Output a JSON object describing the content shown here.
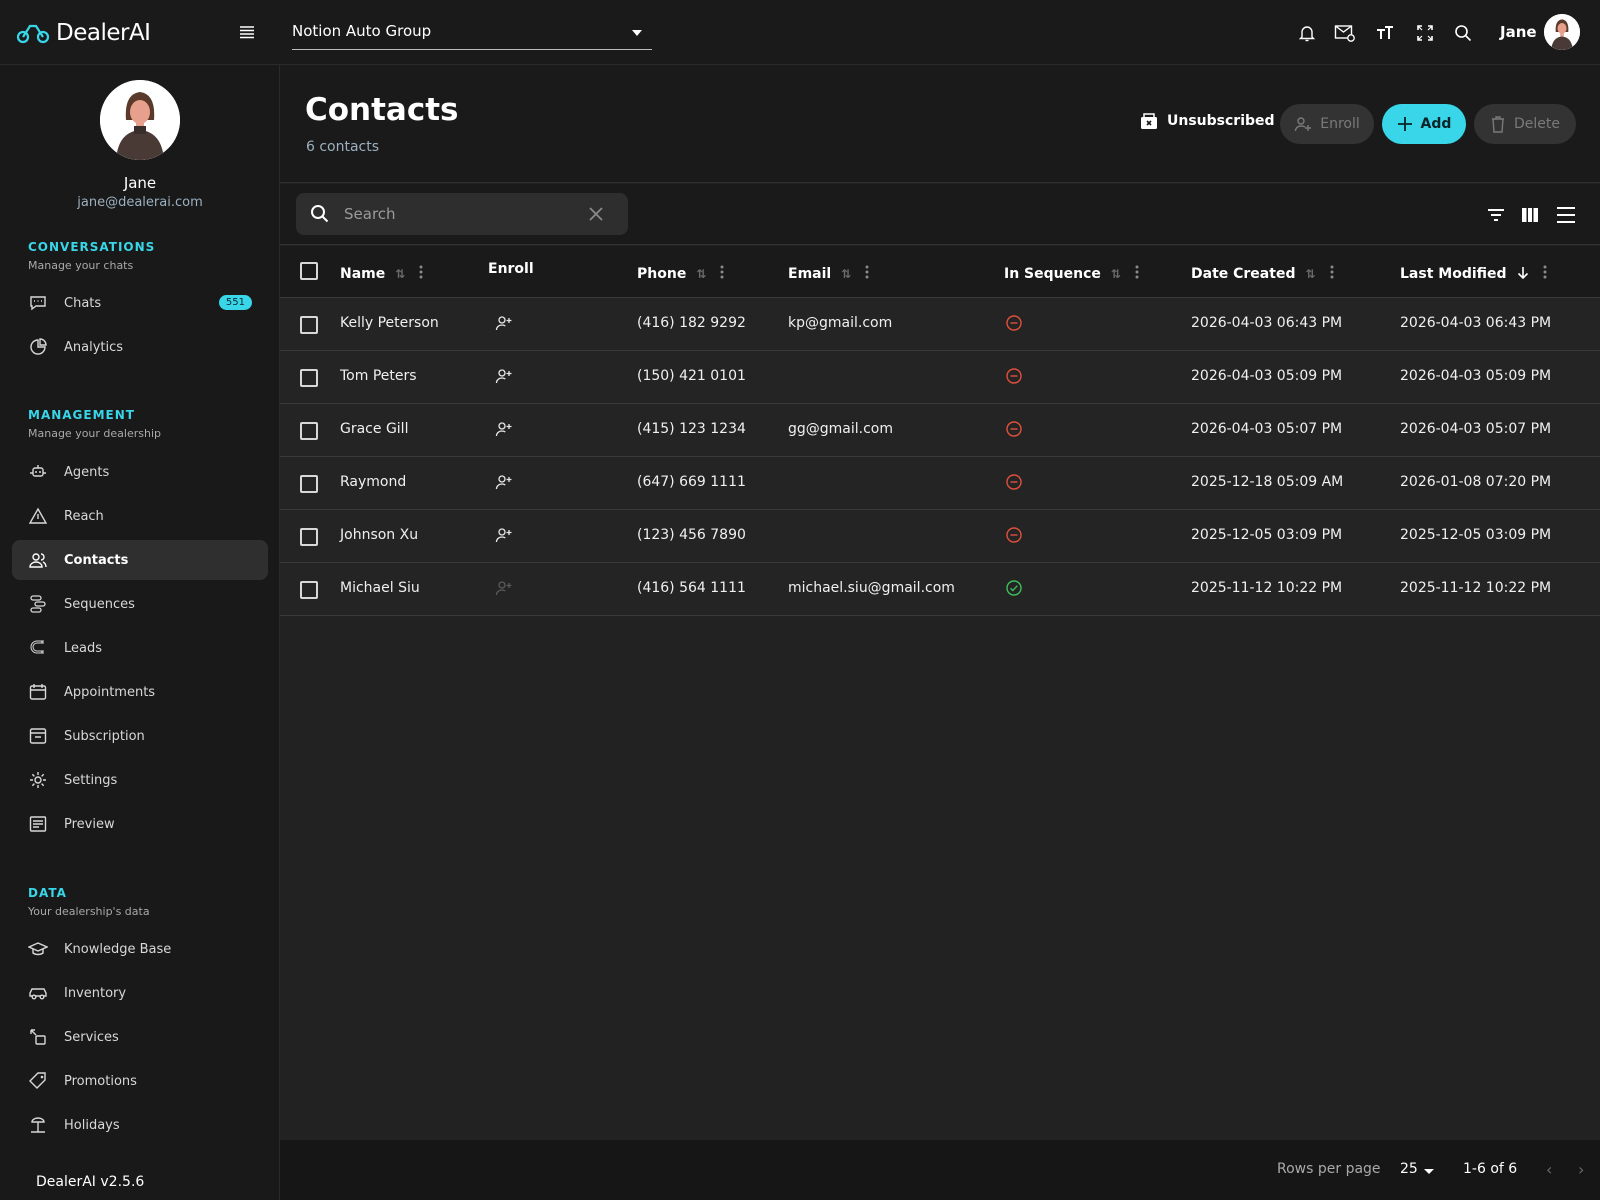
{
  "app": {
    "brand": "DealerAI",
    "version": "DealerAI v2.5.6"
  },
  "topbar": {
    "dealership": "Notion Auto Group",
    "user": "Jane"
  },
  "user": {
    "name": "Jane",
    "email": "jane@dealerai.com"
  },
  "sidebar": {
    "conversations": {
      "title": "CONVERSATIONS",
      "subtitle": "Manage your chats",
      "items": [
        {
          "label": "Chats",
          "icon": "chat-icon",
          "badge": "551"
        },
        {
          "label": "Analytics",
          "icon": "analytics-icon"
        }
      ]
    },
    "management": {
      "title": "MANAGEMENT",
      "subtitle": "Manage your dealership",
      "items": [
        {
          "label": "Agents",
          "icon": "agents-icon"
        },
        {
          "label": "Reach",
          "icon": "reach-icon"
        },
        {
          "label": "Contacts",
          "icon": "contacts-icon",
          "active": true
        },
        {
          "label": "Sequences",
          "icon": "sequences-icon"
        },
        {
          "label": "Leads",
          "icon": "leads-icon"
        },
        {
          "label": "Appointments",
          "icon": "calendar-icon"
        },
        {
          "label": "Subscription",
          "icon": "subscription-icon"
        },
        {
          "label": "Settings",
          "icon": "gear-icon"
        },
        {
          "label": "Preview",
          "icon": "preview-icon"
        }
      ]
    },
    "data": {
      "title": "DATA",
      "subtitle": "Your dealership's data",
      "items": [
        {
          "label": "Knowledge Base",
          "icon": "knowledge-icon"
        },
        {
          "label": "Inventory",
          "icon": "car-icon"
        },
        {
          "label": "Services",
          "icon": "services-icon"
        },
        {
          "label": "Promotions",
          "icon": "tag-icon"
        },
        {
          "label": "Holidays",
          "icon": "holiday-icon"
        }
      ]
    }
  },
  "header": {
    "title": "Contacts",
    "subtitle": "6 contacts",
    "unsubscribed_label": "Unsubscribed",
    "enroll_label": "Enroll",
    "add_label": "Add",
    "delete_label": "Delete"
  },
  "search": {
    "placeholder": "Search",
    "value": ""
  },
  "table": {
    "columns": [
      "Name",
      "Enroll",
      "Phone",
      "Email",
      "In Sequence",
      "Date Created",
      "Last Modified"
    ],
    "rows": [
      {
        "name": "Kelly Peterson",
        "enrollable": true,
        "phone": "(416) 182 9292",
        "email": "kp@gmail.com",
        "in_sequence": false,
        "created": "2026-04-03 06:43 PM",
        "modified": "2026-04-03 06:43 PM"
      },
      {
        "name": "Tom Peters",
        "enrollable": true,
        "phone": "(150) 421 0101",
        "email": "",
        "in_sequence": false,
        "created": "2026-04-03 05:09 PM",
        "modified": "2026-04-03 05:09 PM"
      },
      {
        "name": "Grace Gill",
        "enrollable": true,
        "phone": "(415) 123 1234",
        "email": "gg@gmail.com",
        "in_sequence": false,
        "created": "2026-04-03 05:07 PM",
        "modified": "2026-04-03 05:07 PM"
      },
      {
        "name": "Raymond",
        "enrollable": true,
        "phone": "(647) 669 1111",
        "email": "",
        "in_sequence": false,
        "created": "2025-12-18 05:09 AM",
        "modified": "2026-01-08 07:20 PM"
      },
      {
        "name": "Johnson Xu",
        "enrollable": true,
        "phone": "(123) 456 7890",
        "email": "",
        "in_sequence": false,
        "created": "2025-12-05 03:09 PM",
        "modified": "2025-12-05 03:09 PM"
      },
      {
        "name": "Michael Siu",
        "enrollable": false,
        "phone": "(416) 564 1111",
        "email": "michael.siu@gmail.com",
        "in_sequence": true,
        "created": "2025-11-12 10:22 PM",
        "modified": "2025-11-12 10:22 PM"
      }
    ]
  },
  "footer": {
    "rows_per_page_label": "Rows per page",
    "rows_per_page": "25",
    "range": "1-6 of 6"
  },
  "colors": {
    "accent": "#38d6e8",
    "negative": "#e0503c",
    "positive": "#3cbf5a"
  }
}
